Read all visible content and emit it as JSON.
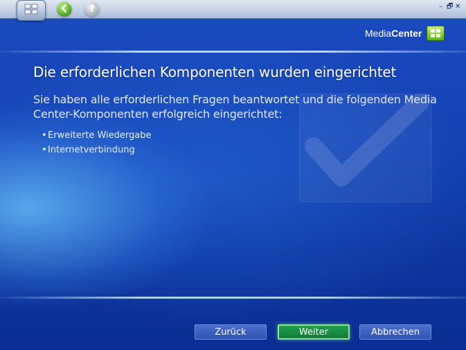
{
  "window": {
    "controls": {
      "minimize": "–",
      "restore": "🗗",
      "close": "✕"
    }
  },
  "toolbar": {
    "start_icon": "windows-flag-icon",
    "back_icon": "back-arrow-icon",
    "help_icon": "help-question-icon",
    "help_glyph": "?",
    "back_glyph": "❮"
  },
  "logo": {
    "part1": "Media",
    "part2": "Center"
  },
  "page": {
    "title": "Die erforderlichen Komponenten wurden eingerichtet",
    "subtitle": "Sie haben alle erforderlichen Fragen beantwortet und die folgenden Media Center-Komponenten erfolgreich eingerichtet:",
    "items": [
      "Erweiterte Wiedergabe",
      "Internetverbindung"
    ],
    "bullet": "•"
  },
  "buttons": {
    "back": "Zurück",
    "next": "Weiter",
    "cancel": "Abbrechen"
  },
  "colors": {
    "background": "#1542b3",
    "accent_green": "#127a37",
    "button_blue": "#2f52b2",
    "text": "#ffffff"
  }
}
